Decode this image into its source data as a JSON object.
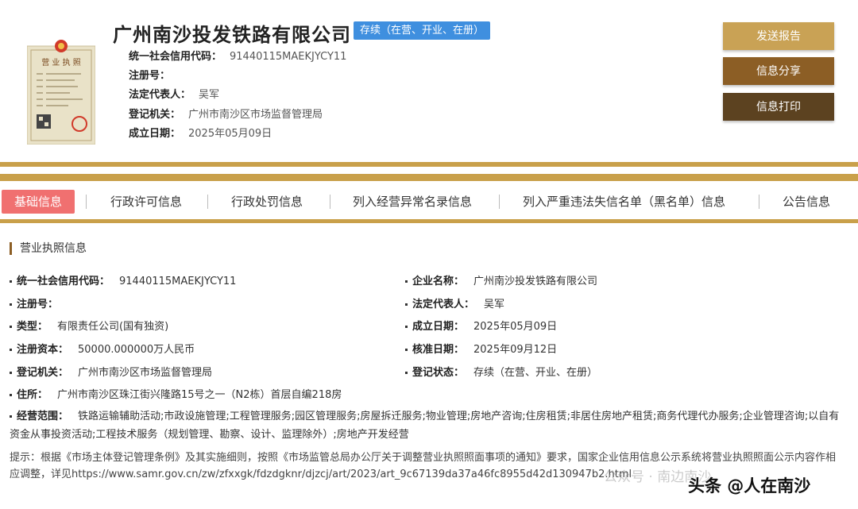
{
  "company": {
    "name": "广州南沙投发铁路有限公司",
    "status": "存续（在营、开业、在册）",
    "meta": [
      {
        "key": "统一社会信用代码：",
        "value": "91440115MAEKJYCY11"
      },
      {
        "key": "注册号：",
        "value": ""
      },
      {
        "key": "法定代表人：",
        "value": "吴军"
      },
      {
        "key": "登记机关：",
        "value": "广州市南沙区市场监督管理局"
      },
      {
        "key": "成立日期：",
        "value": "2025年05月09日"
      }
    ]
  },
  "license_image": {
    "caption": "营 业 执 照",
    "icon": "business-license-icon"
  },
  "buttons": {
    "report": "发送报告",
    "share": "信息分享",
    "print": "信息打印"
  },
  "tabs": [
    "基础信息",
    "行政许可信息",
    "行政处罚信息",
    "列入经营异常名录信息",
    "列入严重违法失信名单（黑名单）信息",
    "公告信息"
  ],
  "section": {
    "title": "营业执照信息"
  },
  "details_left": [
    {
      "key": "统一社会信用代码：",
      "value": "91440115MAEKJYCY11"
    },
    {
      "key": "注册号：",
      "value": ""
    },
    {
      "key": "类型：",
      "value": "有限责任公司(国有独资)"
    },
    {
      "key": "注册资本：",
      "value": "50000.000000万人民币"
    },
    {
      "key": "登记机关：",
      "value": "广州市南沙区市场监督管理局"
    },
    {
      "key": "住所：",
      "value": "广州市南沙区珠江街兴隆路15号之一（N2栋）首层自编218房"
    }
  ],
  "details_right": [
    {
      "key": "企业名称：",
      "value": "广州南沙投发铁路有限公司"
    },
    {
      "key": "法定代表人：",
      "value": "吴军"
    },
    {
      "key": "成立日期：",
      "value": "2025年05月09日"
    },
    {
      "key": "核准日期：",
      "value": "2025年09月12日"
    },
    {
      "key": "登记状态：",
      "value": "存续（在营、开业、在册）"
    }
  ],
  "scope": {
    "key": "经营范围：",
    "value": "铁路运输辅助活动;市政设施管理;工程管理服务;园区管理服务;房屋拆迁服务;物业管理;房地产咨询;住房租赁;非居住房地产租赁;商务代理代办服务;企业管理咨询;以自有资金从事投资活动;工程技术服务（规划管理、勘察、设计、监理除外）;房地产开发经营"
  },
  "notice": "提示：根据《市场主体登记管理条例》及其实施细则，按照《市场监管总局办公厅关于调整营业执照照面事项的通知》要求，国家企业信用信息公示系统将营业执照照面公示内容作相应调整，详见https://www.samr.gov.cn/zw/zfxxgk/fdzdgknr/djzcj/art/2023/art_9c67139da37a46fc8955d42d130947b2.html",
  "watermark": {
    "text": "公众号 · 南边南沙",
    "logo": "头条 @人在南沙"
  },
  "colors": {
    "gold": "#c9a04a",
    "badge": "#3f8fdf",
    "tab_active": "#f07070",
    "btn_report": "#c9a255",
    "btn_share": "#8c5e25",
    "btn_print": "#5c4220"
  }
}
